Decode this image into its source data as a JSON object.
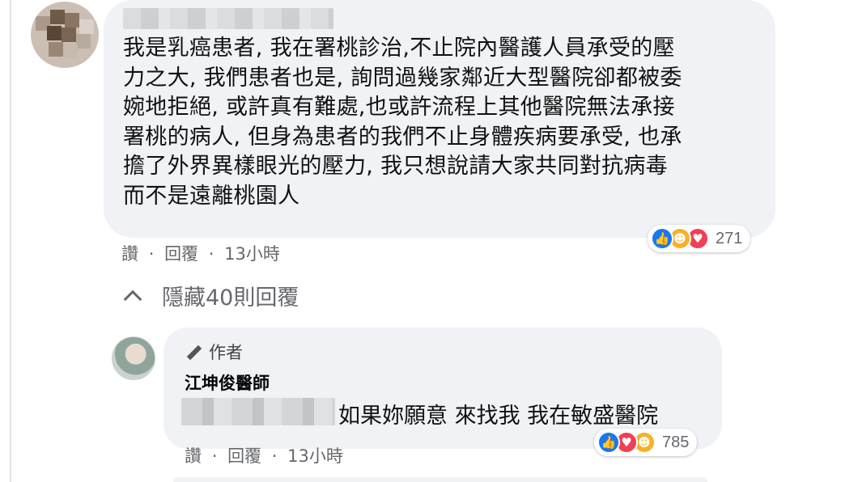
{
  "comment": {
    "lines": [
      "我是乳癌患者, 我在署桃診治,不止院內醫護人員承受的壓",
      "力之大, 我們患者也是, 詢問過幾家鄰近大型醫院卻都被委",
      "婉地拒絕, 或許真有難處,也或許流程上其他醫院無法承接",
      "署桃的病人, 但身為患者的我們不止身體疾病要承受, 也承",
      "擔了外界異樣眼光的壓力, 我只想說請大家共同對抗病毒",
      "而不是遠離桃園人"
    ],
    "actions": {
      "like": "讚",
      "dot1": "·",
      "reply": "回覆",
      "dot2": "·",
      "time": "13小時"
    },
    "reactions": {
      "count": "271",
      "icons": [
        "like-icon",
        "care-icon",
        "love-icon"
      ]
    }
  },
  "hide_replies": {
    "label": "隱藏40則回覆"
  },
  "reply": {
    "badge": "作者",
    "name": "江坤俊醫師",
    "text": "如果妳願意 來找我 我在敏盛醫院",
    "actions": {
      "like": "讚",
      "dot1": "·",
      "reply": "回覆",
      "dot2": "·",
      "time": "13小時"
    },
    "reactions": {
      "count": "785",
      "icons": [
        "like-icon",
        "love-icon",
        "care-icon"
      ]
    }
  },
  "colors": {
    "bubble": "#f0f2f5",
    "secondary_text": "#65676b",
    "like": "#1877f2",
    "love": "#f33e58",
    "care": "#f7b125"
  }
}
